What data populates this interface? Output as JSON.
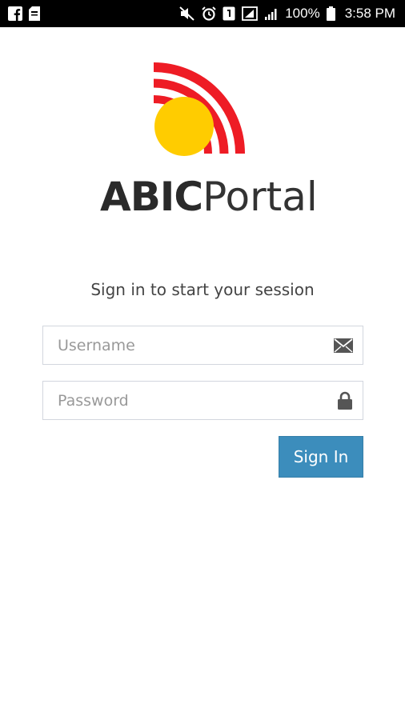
{
  "status_bar": {
    "battery_percent": "100%",
    "time": "3:58 PM",
    "left_icons": [
      "facebook-icon",
      "sd-card-icon"
    ],
    "right_icons": [
      "mute-icon",
      "alarm-icon",
      "sim-icon",
      "wifi-calling-icon",
      "signal-icon",
      "battery-icon"
    ]
  },
  "brand": {
    "bold": "ABIC",
    "light": "Portal",
    "colors": {
      "arcs": "#ee1c25",
      "sun": "#ffcc00",
      "text": "#2a2a2a"
    }
  },
  "login": {
    "message": "Sign in to start your session",
    "username": {
      "placeholder": "Username",
      "value": "",
      "icon": "envelope-icon"
    },
    "password": {
      "placeholder": "Password",
      "value": "",
      "icon": "lock-icon"
    },
    "submit_label": "Sign In",
    "accent_color": "#3c8dbc"
  }
}
